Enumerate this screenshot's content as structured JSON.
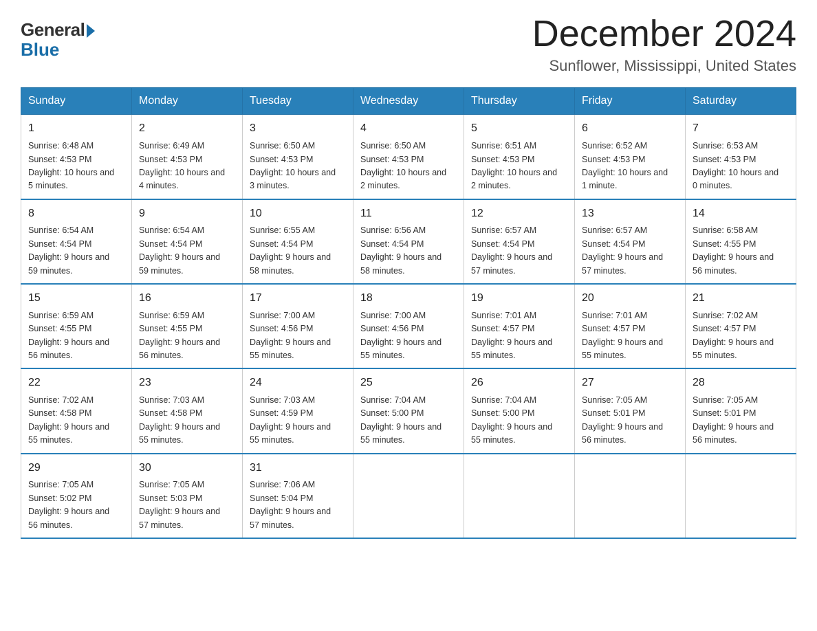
{
  "header": {
    "logo_general": "General",
    "logo_blue": "Blue",
    "month_year": "December 2024",
    "location": "Sunflower, Mississippi, United States"
  },
  "days_of_week": [
    "Sunday",
    "Monday",
    "Tuesday",
    "Wednesday",
    "Thursday",
    "Friday",
    "Saturday"
  ],
  "weeks": [
    [
      {
        "day": "1",
        "sunrise": "6:48 AM",
        "sunset": "4:53 PM",
        "daylight": "10 hours and 5 minutes."
      },
      {
        "day": "2",
        "sunrise": "6:49 AM",
        "sunset": "4:53 PM",
        "daylight": "10 hours and 4 minutes."
      },
      {
        "day": "3",
        "sunrise": "6:50 AM",
        "sunset": "4:53 PM",
        "daylight": "10 hours and 3 minutes."
      },
      {
        "day": "4",
        "sunrise": "6:50 AM",
        "sunset": "4:53 PM",
        "daylight": "10 hours and 2 minutes."
      },
      {
        "day": "5",
        "sunrise": "6:51 AM",
        "sunset": "4:53 PM",
        "daylight": "10 hours and 2 minutes."
      },
      {
        "day": "6",
        "sunrise": "6:52 AM",
        "sunset": "4:53 PM",
        "daylight": "10 hours and 1 minute."
      },
      {
        "day": "7",
        "sunrise": "6:53 AM",
        "sunset": "4:53 PM",
        "daylight": "10 hours and 0 minutes."
      }
    ],
    [
      {
        "day": "8",
        "sunrise": "6:54 AM",
        "sunset": "4:54 PM",
        "daylight": "9 hours and 59 minutes."
      },
      {
        "day": "9",
        "sunrise": "6:54 AM",
        "sunset": "4:54 PM",
        "daylight": "9 hours and 59 minutes."
      },
      {
        "day": "10",
        "sunrise": "6:55 AM",
        "sunset": "4:54 PM",
        "daylight": "9 hours and 58 minutes."
      },
      {
        "day": "11",
        "sunrise": "6:56 AM",
        "sunset": "4:54 PM",
        "daylight": "9 hours and 58 minutes."
      },
      {
        "day": "12",
        "sunrise": "6:57 AM",
        "sunset": "4:54 PM",
        "daylight": "9 hours and 57 minutes."
      },
      {
        "day": "13",
        "sunrise": "6:57 AM",
        "sunset": "4:54 PM",
        "daylight": "9 hours and 57 minutes."
      },
      {
        "day": "14",
        "sunrise": "6:58 AM",
        "sunset": "4:55 PM",
        "daylight": "9 hours and 56 minutes."
      }
    ],
    [
      {
        "day": "15",
        "sunrise": "6:59 AM",
        "sunset": "4:55 PM",
        "daylight": "9 hours and 56 minutes."
      },
      {
        "day": "16",
        "sunrise": "6:59 AM",
        "sunset": "4:55 PM",
        "daylight": "9 hours and 56 minutes."
      },
      {
        "day": "17",
        "sunrise": "7:00 AM",
        "sunset": "4:56 PM",
        "daylight": "9 hours and 55 minutes."
      },
      {
        "day": "18",
        "sunrise": "7:00 AM",
        "sunset": "4:56 PM",
        "daylight": "9 hours and 55 minutes."
      },
      {
        "day": "19",
        "sunrise": "7:01 AM",
        "sunset": "4:57 PM",
        "daylight": "9 hours and 55 minutes."
      },
      {
        "day": "20",
        "sunrise": "7:01 AM",
        "sunset": "4:57 PM",
        "daylight": "9 hours and 55 minutes."
      },
      {
        "day": "21",
        "sunrise": "7:02 AM",
        "sunset": "4:57 PM",
        "daylight": "9 hours and 55 minutes."
      }
    ],
    [
      {
        "day": "22",
        "sunrise": "7:02 AM",
        "sunset": "4:58 PM",
        "daylight": "9 hours and 55 minutes."
      },
      {
        "day": "23",
        "sunrise": "7:03 AM",
        "sunset": "4:58 PM",
        "daylight": "9 hours and 55 minutes."
      },
      {
        "day": "24",
        "sunrise": "7:03 AM",
        "sunset": "4:59 PM",
        "daylight": "9 hours and 55 minutes."
      },
      {
        "day": "25",
        "sunrise": "7:04 AM",
        "sunset": "5:00 PM",
        "daylight": "9 hours and 55 minutes."
      },
      {
        "day": "26",
        "sunrise": "7:04 AM",
        "sunset": "5:00 PM",
        "daylight": "9 hours and 55 minutes."
      },
      {
        "day": "27",
        "sunrise": "7:05 AM",
        "sunset": "5:01 PM",
        "daylight": "9 hours and 56 minutes."
      },
      {
        "day": "28",
        "sunrise": "7:05 AM",
        "sunset": "5:01 PM",
        "daylight": "9 hours and 56 minutes."
      }
    ],
    [
      {
        "day": "29",
        "sunrise": "7:05 AM",
        "sunset": "5:02 PM",
        "daylight": "9 hours and 56 minutes."
      },
      {
        "day": "30",
        "sunrise": "7:05 AM",
        "sunset": "5:03 PM",
        "daylight": "9 hours and 57 minutes."
      },
      {
        "day": "31",
        "sunrise": "7:06 AM",
        "sunset": "5:04 PM",
        "daylight": "9 hours and 57 minutes."
      },
      null,
      null,
      null,
      null
    ]
  ],
  "labels": {
    "sunrise": "Sunrise:",
    "sunset": "Sunset:",
    "daylight": "Daylight:"
  },
  "colors": {
    "header_bg": "#2980b9",
    "accent": "#1a6ea8"
  }
}
